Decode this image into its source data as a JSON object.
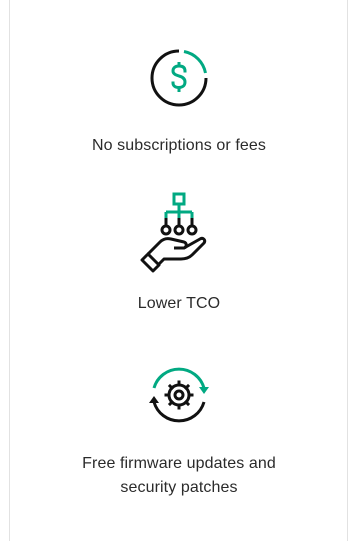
{
  "features": [
    {
      "label": "No subscriptions or fees",
      "icon": "dollar-circle-icon"
    },
    {
      "label": "Lower TCO",
      "icon": "hand-network-icon"
    },
    {
      "label": "Free firmware updates and security patches",
      "label_line1": "Free firmware updates and",
      "label_line2": "security patches",
      "icon": "gear-refresh-icon"
    }
  ],
  "colors": {
    "accent": "#01a982",
    "icon": "#111111",
    "text": "#2b2b2b",
    "border": "#e2e2e2"
  }
}
